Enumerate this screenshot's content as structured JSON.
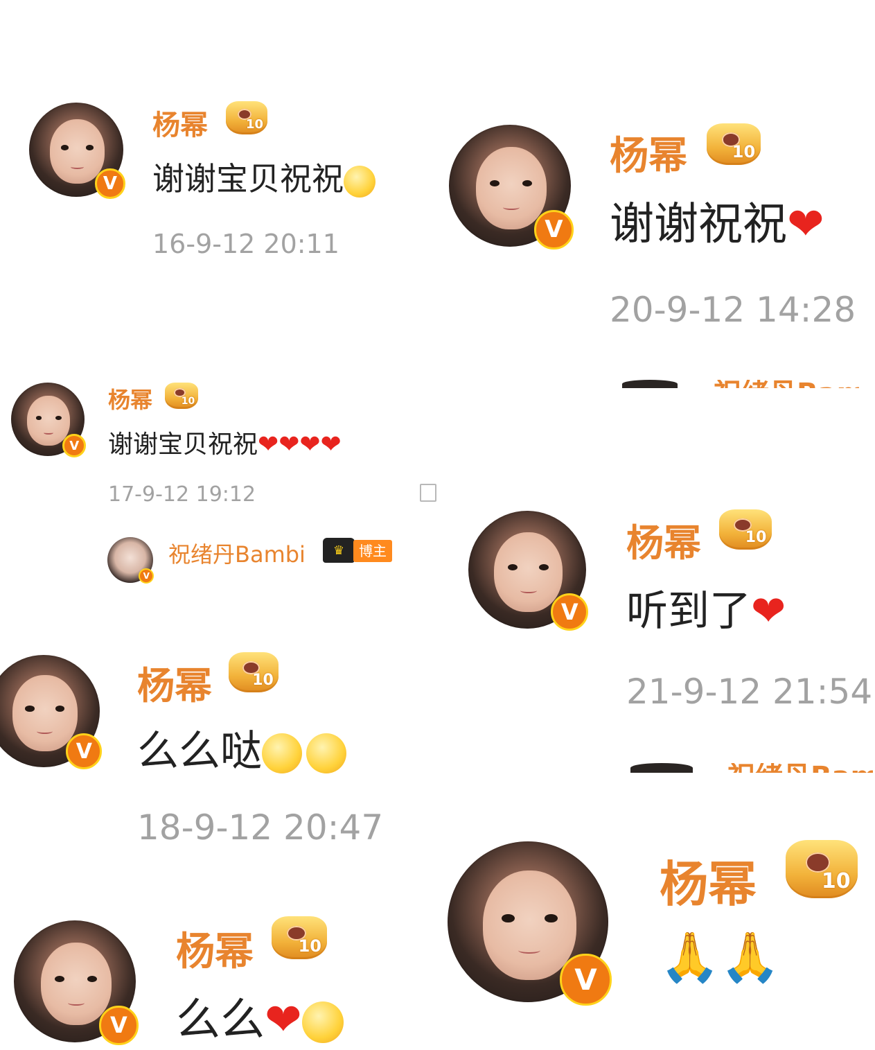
{
  "posts": [
    {
      "name": "杨幂",
      "level": "10",
      "message": "谢谢宝贝祝祝",
      "time": "16-9-12 20:11"
    },
    {
      "name": "杨幂",
      "level": "10",
      "message": "谢谢祝祝",
      "time": "20-9-12 14:28"
    },
    {
      "name": "杨幂",
      "level": "10",
      "message": "谢谢宝贝祝祝",
      "time": "17-9-12 19:12"
    },
    {
      "name": "杨幂",
      "level": "10",
      "message": "听到了",
      "time": "21-9-12 21:54"
    },
    {
      "name": "杨幂",
      "level": "10",
      "message": "么么哒",
      "time": "18-9-12 20:47"
    },
    {
      "name": "杨幂",
      "level": "10",
      "message": "么么"
    },
    {
      "name": "杨幂",
      "level": "10"
    }
  ],
  "reply_user": {
    "name": "祝绪丹Bambi",
    "tag": "博主"
  },
  "badge_letter": "V",
  "emoji": {
    "heart": "❤",
    "pray": "🙏"
  },
  "colors": {
    "username": "#e8842e",
    "timestamp": "#a2a2a2",
    "heart": "#e8241e",
    "verified": "#f07a12"
  }
}
